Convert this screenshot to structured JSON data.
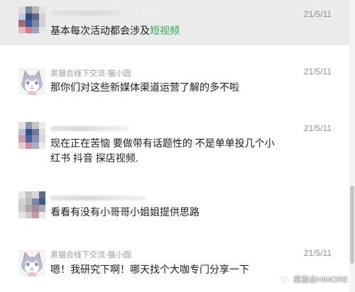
{
  "messages": [
    {
      "sender": "",
      "time": "21/5/11",
      "text_before": "基本每次活动都会涉及",
      "text_link": "短视频",
      "avatar": "blurred-avatar"
    },
    {
      "sender": "黑猫会线下交流-猫小圆",
      "time": "21/5/11",
      "text": "那你们对这些新媒体渠道运营了解的多不啦",
      "avatar": "cartoon-cat-avatar"
    },
    {
      "sender": "",
      "time": "21/5/11",
      "text_line1": "现在正在苦恼 要做带有话题性的 不是单单投几个小",
      "text_line2": "红书 抖音 探店视频.",
      "avatar": "blurred-avatar"
    },
    {
      "sender": "",
      "time": "21/5/11",
      "text": "看看有没有小哥哥小姐姐提供思路",
      "avatar": "blurred-avatar"
    },
    {
      "sender": "黑猫会线下交流-猫小圆",
      "time": "21/5/11",
      "text": "嗯！我研究下啊！哪天找个大咖专门分享一下",
      "avatar": "cartoon-cat-avatar"
    }
  ],
  "watermark": {
    "text": "黑猫会HIMORE",
    "icon": "wechat-channel-icon"
  },
  "colors": {
    "highlight_row": "#ececec",
    "link_green": "#37a44d",
    "time_gray": "#8e8e8e"
  }
}
